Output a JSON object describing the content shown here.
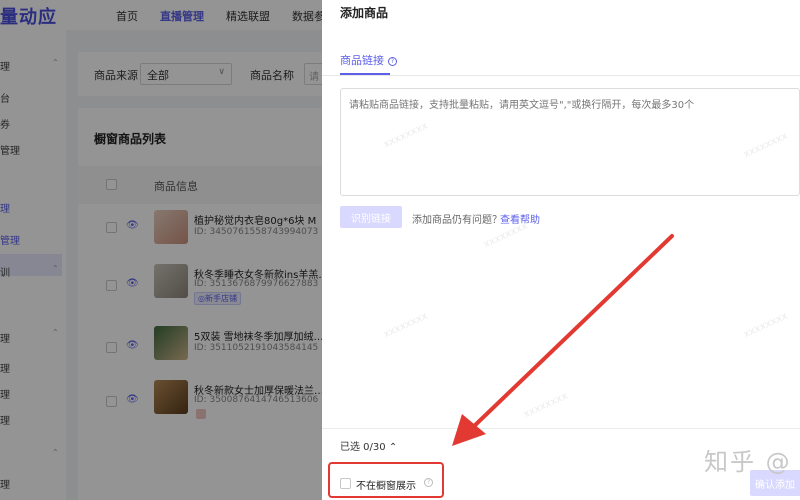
{
  "app": {
    "logo": "量动应"
  },
  "top_nav": [
    "首页",
    "直播管理",
    "精选联盟",
    "数据参"
  ],
  "top_nav_active": 1,
  "sidebar": {
    "items": [
      "理",
      "台",
      "券",
      "管理",
      "理",
      "管理",
      "训",
      "",
      "理",
      "理",
      "理",
      "理",
      "理",
      "理"
    ]
  },
  "filter": {
    "source_label": "商品来源",
    "source_value": "全部",
    "name_label": "商品名称",
    "name_placeholder": "请"
  },
  "list": {
    "title": "橱窗商品列表",
    "column_header": "商品信息",
    "products": [
      {
        "title": "植护秘觉内衣皂80g*6块 M",
        "id": "ID: 3450761558743994073",
        "tag": ""
      },
      {
        "title": "秋冬季睡衣女冬新款ins羊羔…",
        "id": "ID: 3513676879976627883",
        "tag": "新手店铺"
      },
      {
        "title": "5双装 雪地袜冬季加厚加绒…",
        "id": "ID: 3511052191043584145",
        "tag": ""
      },
      {
        "title": "秋冬新款女士加厚保暖法兰…",
        "id": "ID: 3500876414746513606",
        "tag": ""
      }
    ]
  },
  "drawer": {
    "title": "添加商品",
    "tab_label": "商品链接",
    "textarea_placeholder": "请粘贴商品链接，支持批量粘贴，请用英文逗号\",\"或换行隔开，每次最多30个",
    "recognize_button": "识别链接",
    "help_text": "添加商品仍有问题？",
    "help_link": "查看帮助",
    "selected_text": "已选 0/30",
    "hide_checkbox_label": "不在橱窗展示",
    "confirm_button": "确认添加"
  },
  "watermark_brand": "知乎 @",
  "colors": {
    "accent": "#5c5fe8",
    "highlight_red": "#e23a32"
  }
}
